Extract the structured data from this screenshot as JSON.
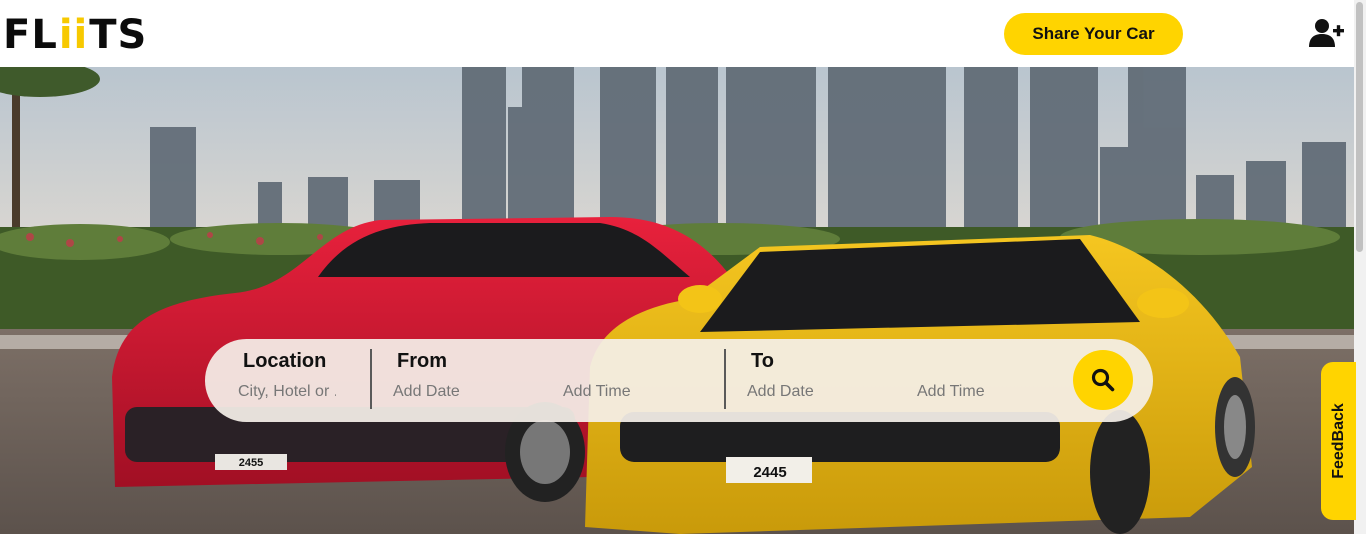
{
  "brand": {
    "logo_prefix": "FL",
    "logo_ii": "ii",
    "logo_suffix": "TS"
  },
  "header": {
    "share_button": "Share Your Car",
    "user_add_icon": "user-plus-icon"
  },
  "search": {
    "location": {
      "title": "Location",
      "placeholder": "City, Hotel or ."
    },
    "from": {
      "title": "From",
      "date_placeholder": "Add Date",
      "time_placeholder": "Add Time"
    },
    "to": {
      "title": "To",
      "date_placeholder": "Add Date",
      "time_placeholder": "Add Time"
    },
    "button_icon": "search-icon"
  },
  "feedback": {
    "label": "FeedBack"
  },
  "hero": {
    "plate_red": "2455",
    "plate_yellow": "2445"
  },
  "colors": {
    "accent": "#ffd400",
    "text": "#111111",
    "bar": "#f4efe8"
  }
}
